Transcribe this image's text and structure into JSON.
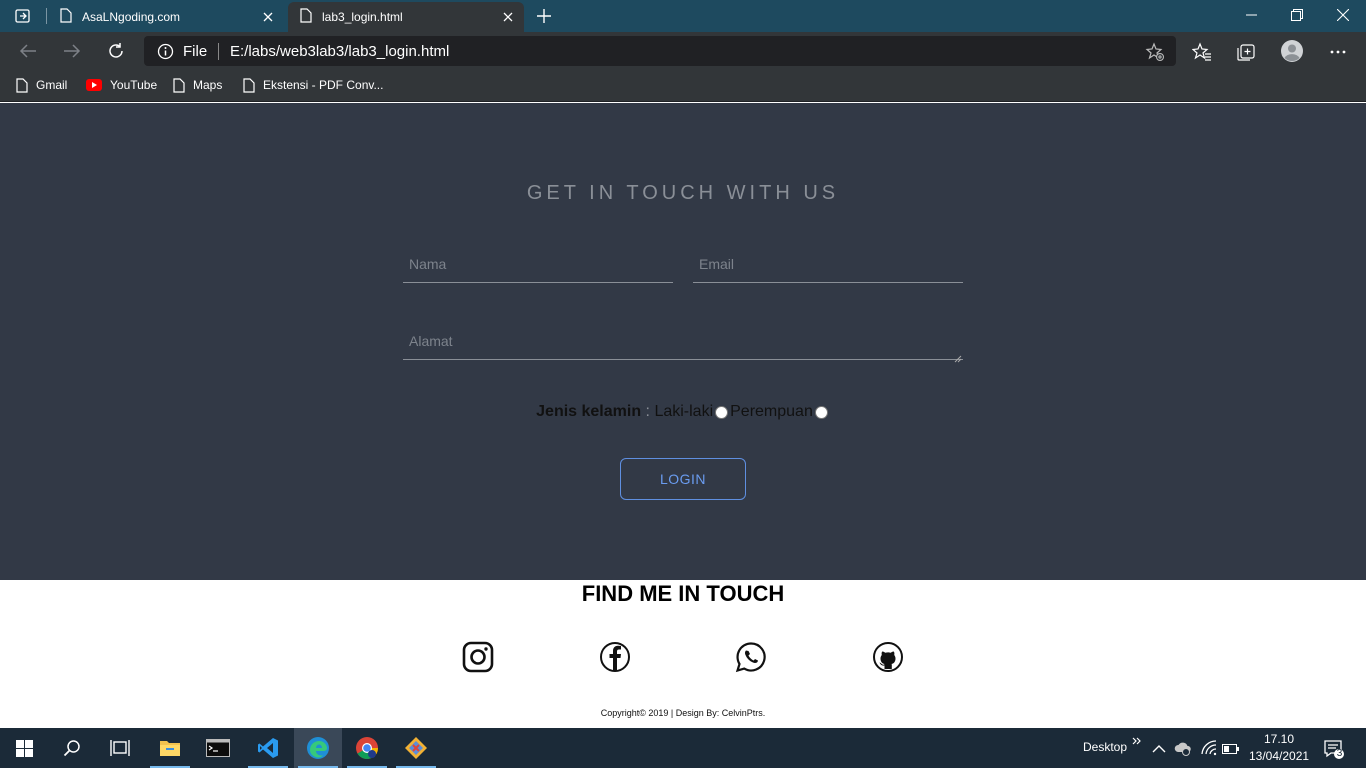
{
  "browser": {
    "tabs": [
      {
        "title": "AsaLNgoding.com",
        "active": false
      },
      {
        "title": "lab3_login.html",
        "active": true
      }
    ],
    "address": {
      "scheme_label": "File",
      "url": "E:/labs/web3lab3/lab3_login.html"
    },
    "bookmarks": [
      {
        "label": "Gmail",
        "icon": "page-icon"
      },
      {
        "label": "YouTube",
        "icon": "youtube-icon"
      },
      {
        "label": "Maps",
        "icon": "page-icon"
      },
      {
        "label": "Ekstensi - PDF Conv...",
        "icon": "page-icon"
      }
    ]
  },
  "page": {
    "heading": "GET IN TOUCH WITH US",
    "form": {
      "nama_placeholder": "Nama",
      "email_placeholder": "Email",
      "alamat_placeholder": "Alamat",
      "gender_label": "Jenis kelamin",
      "gender_sep": " : ",
      "option_male": "Laki-laki",
      "option_female": "Perempuan",
      "login_label": "LOGIN"
    },
    "footer": {
      "heading": "FIND ME IN TOUCH",
      "socials": [
        "instagram-icon",
        "facebook-icon",
        "whatsapp-icon",
        "github-icon"
      ],
      "copyright": "Copyright© 2019 | Design By: CelvinPtrs."
    }
  },
  "taskbar": {
    "desktop_label": "Desktop",
    "time": "17.10",
    "date": "13/04/2021",
    "notification_count": "3"
  },
  "colors": {
    "titlebar": "#1e4a5f",
    "page_bg": "#323946",
    "accent_button": "#5f8fe0",
    "taskbar": "#1b2a38"
  }
}
